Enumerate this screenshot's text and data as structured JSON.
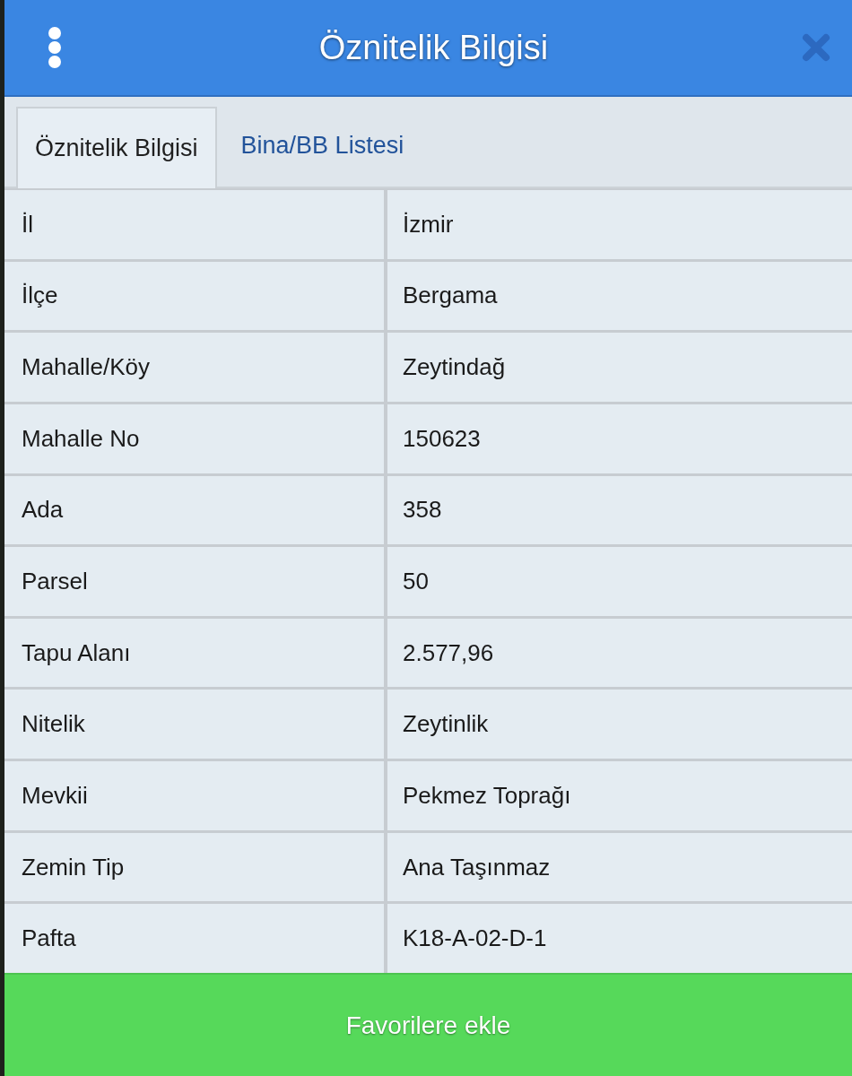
{
  "header": {
    "title": "Öznitelik Bilgisi"
  },
  "tabs": [
    {
      "label": "Öznitelik Bilgisi",
      "selected": true
    },
    {
      "label": "Bina/BB Listesi",
      "selected": false
    }
  ],
  "table": {
    "rows": [
      {
        "label": "İl",
        "value": "İzmir"
      },
      {
        "label": "İlçe",
        "value": "Bergama"
      },
      {
        "label": "Mahalle/Köy",
        "value": "Zeytindağ"
      },
      {
        "label": "Mahalle No",
        "value": "150623"
      },
      {
        "label": "Ada",
        "value": "358"
      },
      {
        "label": "Parsel",
        "value": "50"
      },
      {
        "label": "Tapu Alanı",
        "value": "2.577,96"
      },
      {
        "label": "Nitelik",
        "value": "Zeytinlik"
      },
      {
        "label": "Mevkii",
        "value": "Pekmez Toprağı"
      },
      {
        "label": "Zemin Tip",
        "value": "Ana Taşınmaz"
      },
      {
        "label": "Pafta",
        "value": "K18-A-02-D-1"
      }
    ]
  },
  "footer_button": {
    "label": "Favorilere ekle"
  }
}
